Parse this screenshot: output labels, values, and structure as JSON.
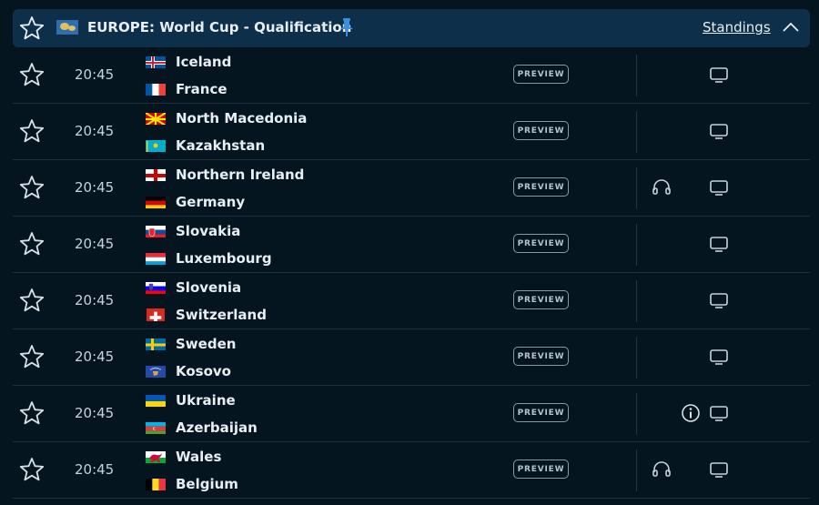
{
  "header": {
    "title": "EUROPE: World Cup - Qualification",
    "standings_label": "Standings"
  },
  "matches": [
    {
      "time": "20:45",
      "home": "Iceland",
      "away": "France",
      "home_flag": "iceland",
      "away_flag": "france",
      "preview": "PREVIEW",
      "audio": false,
      "info": false
    },
    {
      "time": "20:45",
      "home": "North Macedonia",
      "away": "Kazakhstan",
      "home_flag": "north-macedonia",
      "away_flag": "kazakhstan",
      "preview": "PREVIEW",
      "audio": false,
      "info": false
    },
    {
      "time": "20:45",
      "home": "Northern Ireland",
      "away": "Germany",
      "home_flag": "northern-ireland",
      "away_flag": "germany",
      "preview": "PREVIEW",
      "audio": true,
      "info": false
    },
    {
      "time": "20:45",
      "home": "Slovakia",
      "away": "Luxembourg",
      "home_flag": "slovakia",
      "away_flag": "luxembourg",
      "preview": "PREVIEW",
      "audio": false,
      "info": false
    },
    {
      "time": "20:45",
      "home": "Slovenia",
      "away": "Switzerland",
      "home_flag": "slovenia",
      "away_flag": "switzerland",
      "preview": "PREVIEW",
      "audio": false,
      "info": false
    },
    {
      "time": "20:45",
      "home": "Sweden",
      "away": "Kosovo",
      "home_flag": "sweden",
      "away_flag": "kosovo",
      "preview": "PREVIEW",
      "audio": false,
      "info": false
    },
    {
      "time": "20:45",
      "home": "Ukraine",
      "away": "Azerbaijan",
      "home_flag": "ukraine",
      "away_flag": "azerbaijan",
      "preview": "PREVIEW",
      "audio": false,
      "info": true
    },
    {
      "time": "20:45",
      "home": "Wales",
      "away": "Belgium",
      "home_flag": "wales",
      "away_flag": "belgium",
      "preview": "PREVIEW",
      "audio": true,
      "info": false
    }
  ],
  "icons": {
    "star": "star-outline-icon",
    "pin": "pin-icon",
    "chevron": "chevron-up-icon",
    "tv": "tv-icon",
    "audio": "headphones-icon",
    "info": "info-icon",
    "league_flag": "world-flag-icon"
  },
  "colors": {
    "background": "#041520",
    "header_bg": "#0d2f4a",
    "pin": "#3b8fe0",
    "text": "#e9eef2"
  }
}
